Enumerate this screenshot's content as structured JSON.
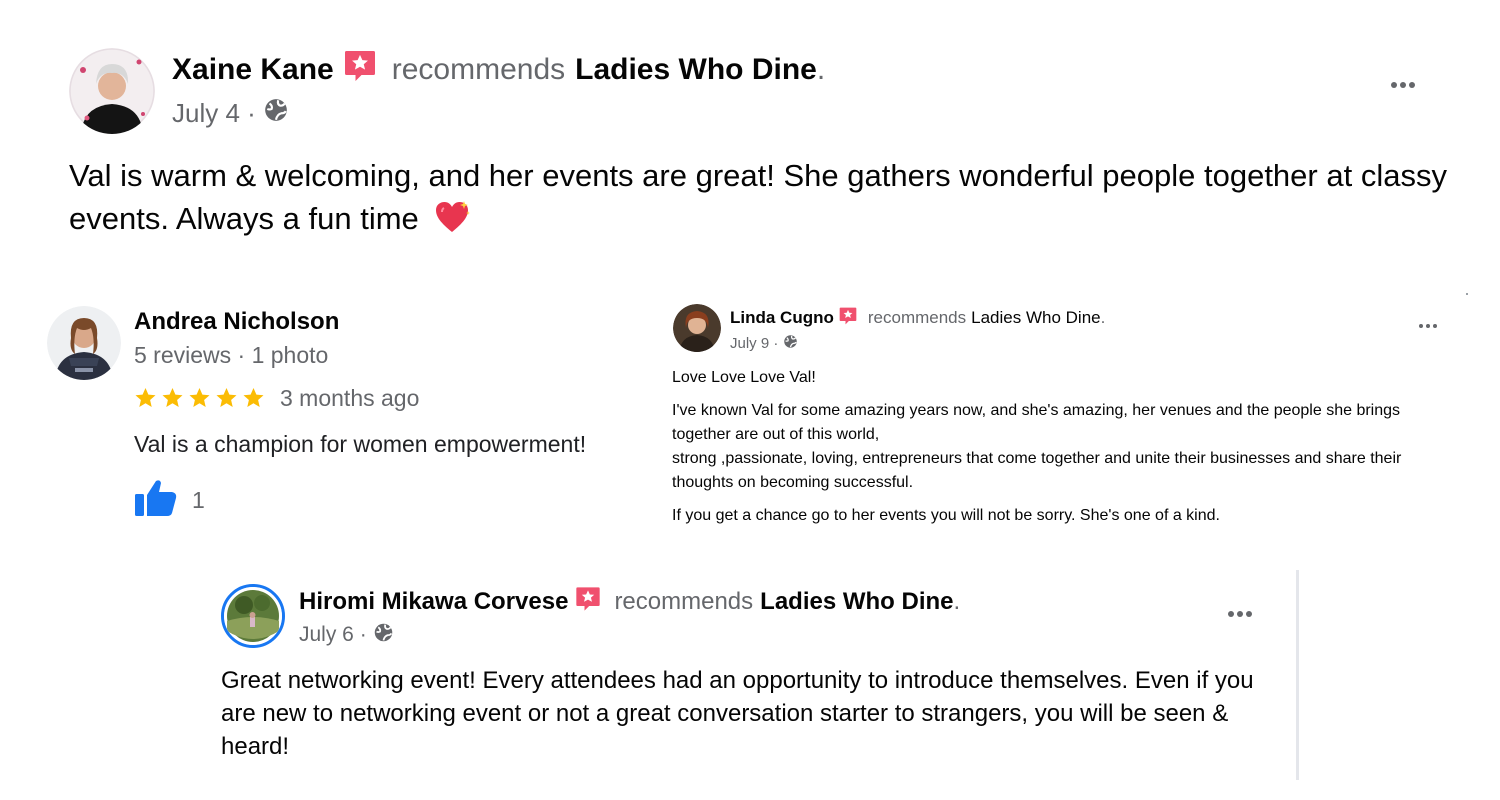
{
  "post1": {
    "author": "Xaine Kane",
    "recommends": "recommends",
    "page": "Ladies Who Dine",
    "period": ".",
    "date": "July 4",
    "sep": " · ",
    "text": "Val is warm & welcoming, and her events are great! She gathers wonderful people together at classy events. Always a fun time"
  },
  "review": {
    "author": "Andrea Nicholson",
    "meta": "5 reviews · 1 photo",
    "stars": 5,
    "time": "3 months ago",
    "text": "Val is a champion for women empowerment!",
    "likes": "1"
  },
  "post2": {
    "author": "Linda Cugno",
    "recommends": "recommends",
    "page": "Ladies Who Dine",
    "period": ".",
    "date": "July 9",
    "sep": " · ",
    "line1": "Love Love Love Val!",
    "para1": "I've known Val for some amazing years now, and she's amazing, her venues and the people she brings together are out of this world,",
    "para2": "strong ,passionate, loving, entrepreneurs that come together and unite their businesses and share their thoughts on becoming successful.",
    "para3": "If you get a chance go to her events you will not be sorry. She's one of a kind."
  },
  "post3": {
    "author": "Hiromi Mikawa Corvese",
    "recommends": "recommends",
    "page": "Ladies Who Dine",
    "period": ".",
    "date": "July 6",
    "sep": " · ",
    "text": "Great networking event! Every attendees had an opportunity to introduce themselves. Even if you are new to networking event or not a great conversation starter to strangers, you will be seen & heard!"
  },
  "icons": {
    "recommend": "recommend-badge-icon",
    "globe": "globe-icon",
    "more": "more-options-icon",
    "star": "star-icon",
    "thumbs_up": "thumbs-up-icon",
    "heart": "sparkling-heart-icon"
  },
  "colors": {
    "recommend_badge": "#f0506e",
    "star": "#fbbc04",
    "like_blue": "#1877f2",
    "muted_text": "#65676b"
  }
}
